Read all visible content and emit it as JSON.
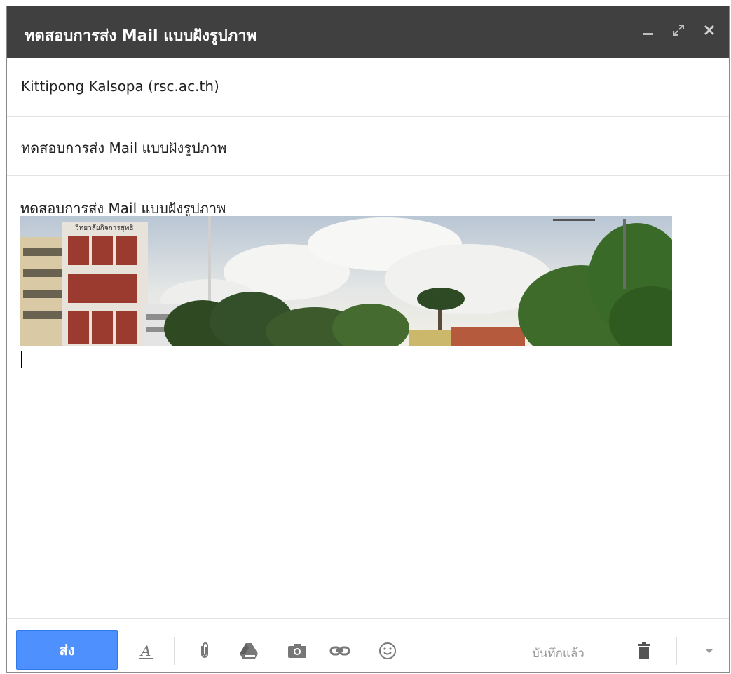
{
  "window": {
    "title": "ทดสอบการส่ง Mail แบบฝังรูปภาพ",
    "controls": [
      "minimize-icon",
      "expand-icon",
      "close-icon"
    ]
  },
  "compose": {
    "to": "Kittipong Kalsopa (rsc.ac.th)",
    "subject": "ทดสอบการส่ง Mail แบบฝังรูปภาพ",
    "body_text": "ทดสอบการส่ง Mail แบบฝังรูปภาพ",
    "inline_image": {
      "sign_text": "วิทยาลัยกิจการสุทธิ"
    }
  },
  "toolbar": {
    "send_label": "ส่ง",
    "saved_status": "บันทึกแล้ว",
    "icons": [
      "formatting-icon",
      "attach-icon",
      "drive-icon",
      "photo-icon",
      "link-icon",
      "emoji-icon",
      "trash-icon",
      "more-options-icon"
    ]
  },
  "colors": {
    "titlebar_bg": "#404040",
    "send_button_bg": "#4d90fe",
    "divider": "#e3e3e3"
  }
}
